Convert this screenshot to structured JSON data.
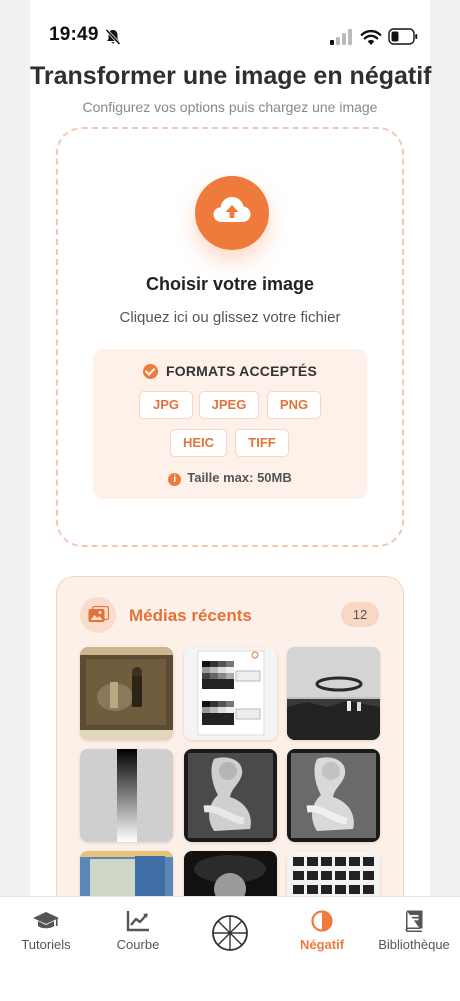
{
  "status_bar": {
    "time": "19:49"
  },
  "header": {
    "title": "Transformer une image en négatif",
    "subtitle": "Configurez vos options puis chargez une image"
  },
  "upload": {
    "title": "Choisir votre image",
    "subtitle": "Cliquez ici ou glissez votre fichier",
    "formats_title": "FORMATS ACCEPTÉS",
    "formats": [
      "JPG",
      "JPEG",
      "PNG",
      "HEIC",
      "TIFF"
    ],
    "max_size": "Taille max: 50MB"
  },
  "recent": {
    "title": "Médias récents",
    "count": "12"
  },
  "tabs": [
    {
      "label": "Tutoriels",
      "icon": "graduation-cap-icon"
    },
    {
      "label": "Courbe",
      "icon": "chart-line-icon"
    },
    {
      "label": "",
      "icon": "aperture-icon"
    },
    {
      "label": "Négatif",
      "icon": "contrast-icon",
      "active": true
    },
    {
      "label": "Bibliothèque",
      "icon": "book-icon"
    }
  ],
  "colors": {
    "accent": "#ee7a3b",
    "accent_light": "#fdf1ea",
    "border": "#f3c8b2"
  }
}
